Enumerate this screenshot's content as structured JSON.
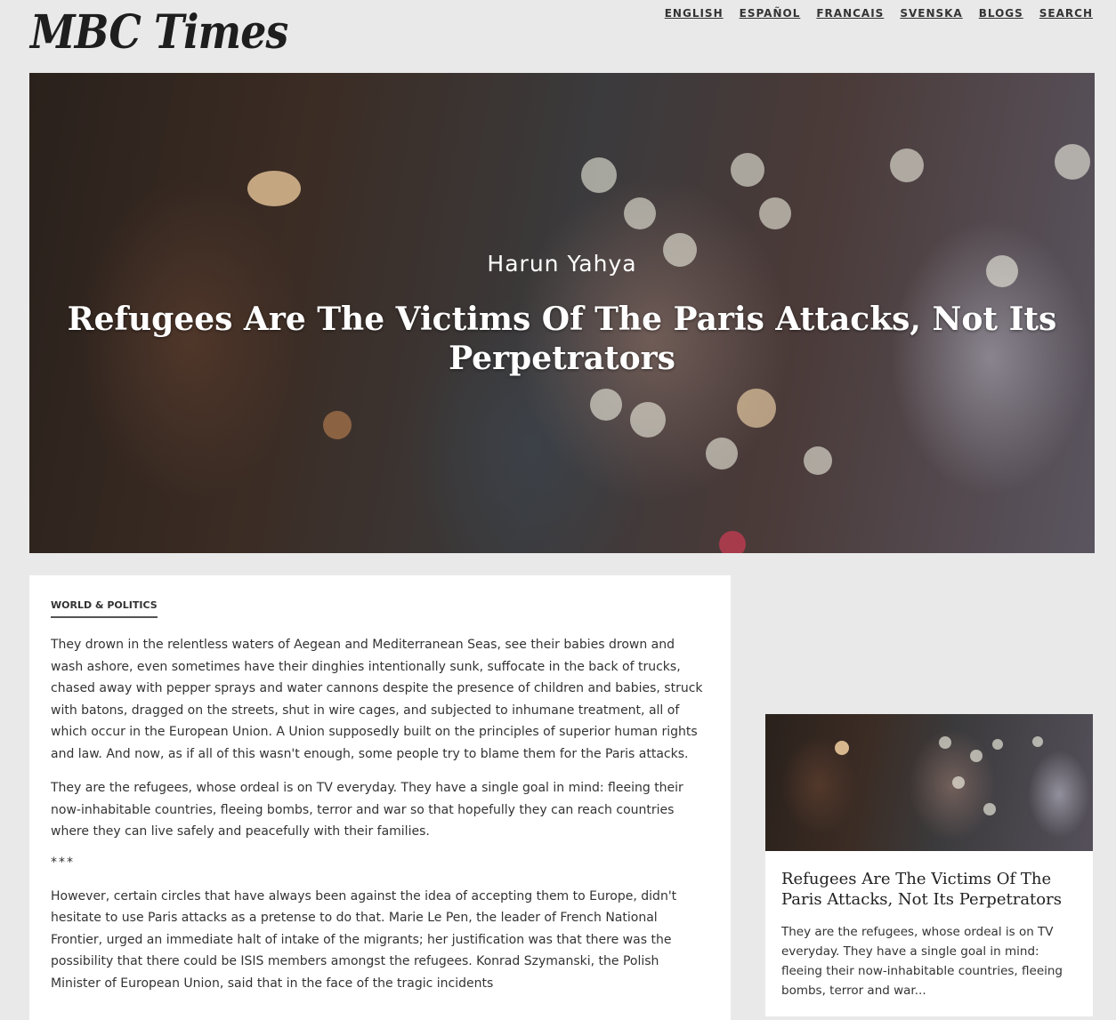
{
  "header": {
    "logo": "MBC Times",
    "nav": [
      "ENGLISH",
      "ESPAÑOL",
      "FRANCAIS",
      "SVENSKA",
      "BLOGS",
      "SEARCH"
    ]
  },
  "hero": {
    "author": "Harun Yahya",
    "title": "Refugees Are The Victims Of The Paris Attacks, Not Its Perpetrators"
  },
  "article": {
    "category": "WORLD & POLITICS",
    "paragraphs": [
      "They drown in the relentless waters of Aegean and Mediterranean Seas, see their babies drown and wash ashore, even sometimes have their dinghies intentionally sunk, suffocate in the back of trucks, chased away with pepper sprays and water cannons despite the presence of children and babies, struck with batons, dragged on the streets, shut in wire cages, and subjected to inhumane treatment, all of which occur in the European Union.  A Union supposedly built on the principles of superior human rights and law. And now, as if all of this wasn't enough, some people try to blame them for the Paris attacks.",
      "They are the refugees, whose ordeal is on TV everyday. They have a single goal in mind: fleeing their now-inhabitable countries, fleeing bombs, terror and war so that hopefully they can reach countries where they can live safely and peacefully with their families.",
      "However, certain circles that have always been against the idea of accepting them to Europe, didn't hesitate to use Paris attacks as a pretense to do that. Marie Le Pen, the leader of French National Frontier, urged an immediate halt of intake of the migrants; her justification was that there was the possibility that there could be ISIS members amongst the refugees. Konrad Szymanski, the Polish Minister of European Union, said that in the face of the tragic incidents"
    ],
    "separator": "***"
  },
  "sidebar_card": {
    "title": "Refugees Are The Victims Of The Paris Attacks, Not Its Perpetrators",
    "excerpt": "They are the refugees, whose ordeal is on TV everyday. They have a single goal in mind: fleeing their now-inhabitable countries, fleeing bombs, terror and war..."
  }
}
